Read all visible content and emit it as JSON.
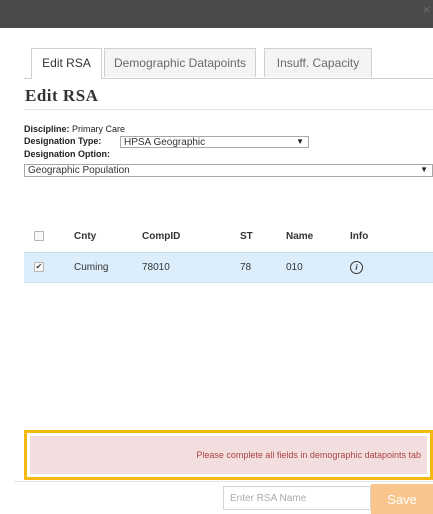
{
  "window": {
    "close_icon": "close-icon"
  },
  "tabs": [
    {
      "label": "Edit RSA",
      "active": true
    },
    {
      "label": "Demographic Datapoints",
      "active": false
    },
    {
      "label": "Insuff. Capacity",
      "active": false
    }
  ],
  "heading": "Edit RSA",
  "discipline": {
    "label": "Discipline:",
    "value": "Primary Care"
  },
  "designation_type": {
    "label": "Designation Type:",
    "value": "HPSA Geographic"
  },
  "designation_option": {
    "label": "Designation Option:",
    "value": "Geographic Population"
  },
  "table": {
    "columns": [
      "",
      "Cnty",
      "CompID",
      "ST",
      "Name",
      "Info"
    ],
    "rows": [
      {
        "checked": true,
        "cnty": "Cuming",
        "compid": "78010",
        "st": "78",
        "name": "010",
        "info_icon": "info-icon"
      }
    ]
  },
  "alert": {
    "text": "Please complete all fields in demographic datapoints tab"
  },
  "footer": {
    "rsa_name_placeholder": "Enter RSA Name",
    "save_label": "Save"
  },
  "colors": {
    "titlebar": "#4a4a4a",
    "alert_border": "#f5b80f",
    "alert_bg": "#f2dede",
    "alert_text": "#a94442",
    "selected_row": "#dceefb",
    "save_button": "#f8c58c"
  }
}
